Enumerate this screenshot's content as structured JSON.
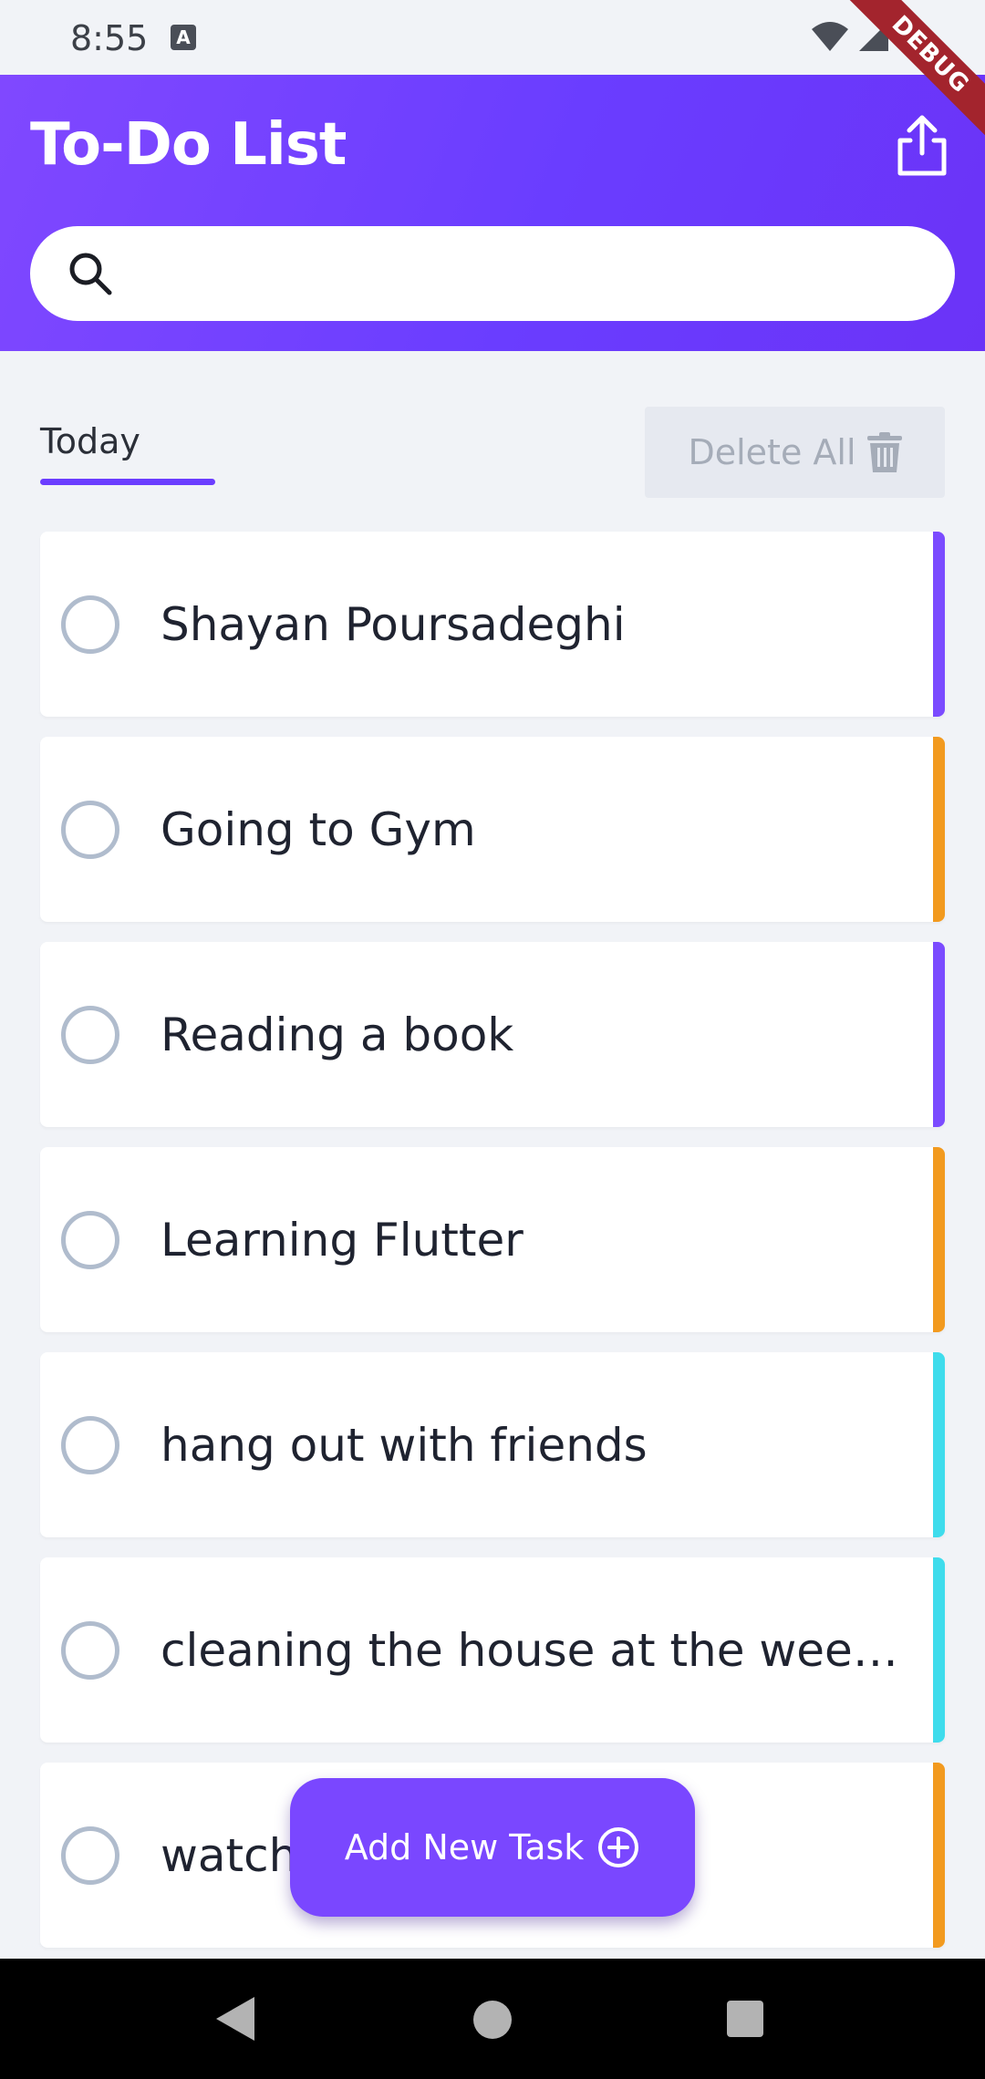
{
  "status_bar": {
    "time": "8:55",
    "notification_icon": "a-icon",
    "icons": [
      "wifi-icon",
      "signal-icon",
      "battery-icon"
    ],
    "debug_label": "DEBUG"
  },
  "header": {
    "title": "To-Do List",
    "share_icon": "share-icon",
    "search": {
      "icon": "search-icon",
      "placeholder": "",
      "value": ""
    }
  },
  "toolbar": {
    "tab_label": "Today",
    "delete_all_label": "Delete All",
    "delete_icon": "trash-icon"
  },
  "colors": {
    "accent_purple": "#7b4bff",
    "accent_orange": "#f29a1f",
    "accent_cyan": "#3fdcec",
    "header_gradient_start": "#8048ff",
    "header_gradient_end": "#6b33f7"
  },
  "tasks": [
    {
      "title": "Shayan Poursadeghi",
      "done": false,
      "color": "#7b4bff"
    },
    {
      "title": "Going to Gym",
      "done": false,
      "color": "#f29a1f"
    },
    {
      "title": "Reading a book",
      "done": false,
      "color": "#7b4bff"
    },
    {
      "title": "Learning Flutter",
      "done": false,
      "color": "#f29a1f"
    },
    {
      "title": "hang out with friends",
      "done": false,
      "color": "#3fdcec"
    },
    {
      "title": "cleaning the house at the week…",
      "done": false,
      "color": "#3fdcec"
    },
    {
      "title": "watch",
      "done": false,
      "color": "#f29a1f"
    }
  ],
  "fab": {
    "label": "Add New Task",
    "icon": "add-circle-icon"
  },
  "nav": {
    "back": "back-icon",
    "home": "home-icon",
    "recents": "recents-icon"
  }
}
